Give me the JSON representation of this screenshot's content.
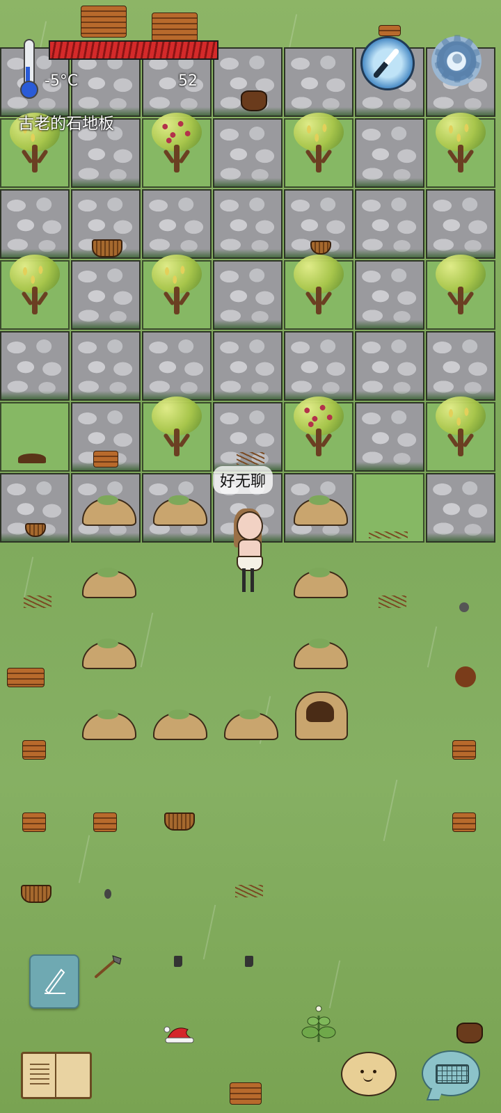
{
  "hud": {
    "temperature": "-5°C",
    "food_count": "52",
    "location_label": "古老的石地板",
    "health_color": "#d42a2a",
    "compass_icon": "compass-icon",
    "settings_icon": "gear-icon"
  },
  "character": {
    "speech": "好无聊"
  },
  "controls": {
    "pen_icon": "pencil-icon",
    "book_icon": "book-icon",
    "emote_icon": "potato-face-icon",
    "keyboard_icon": "keyboard-icon"
  }
}
